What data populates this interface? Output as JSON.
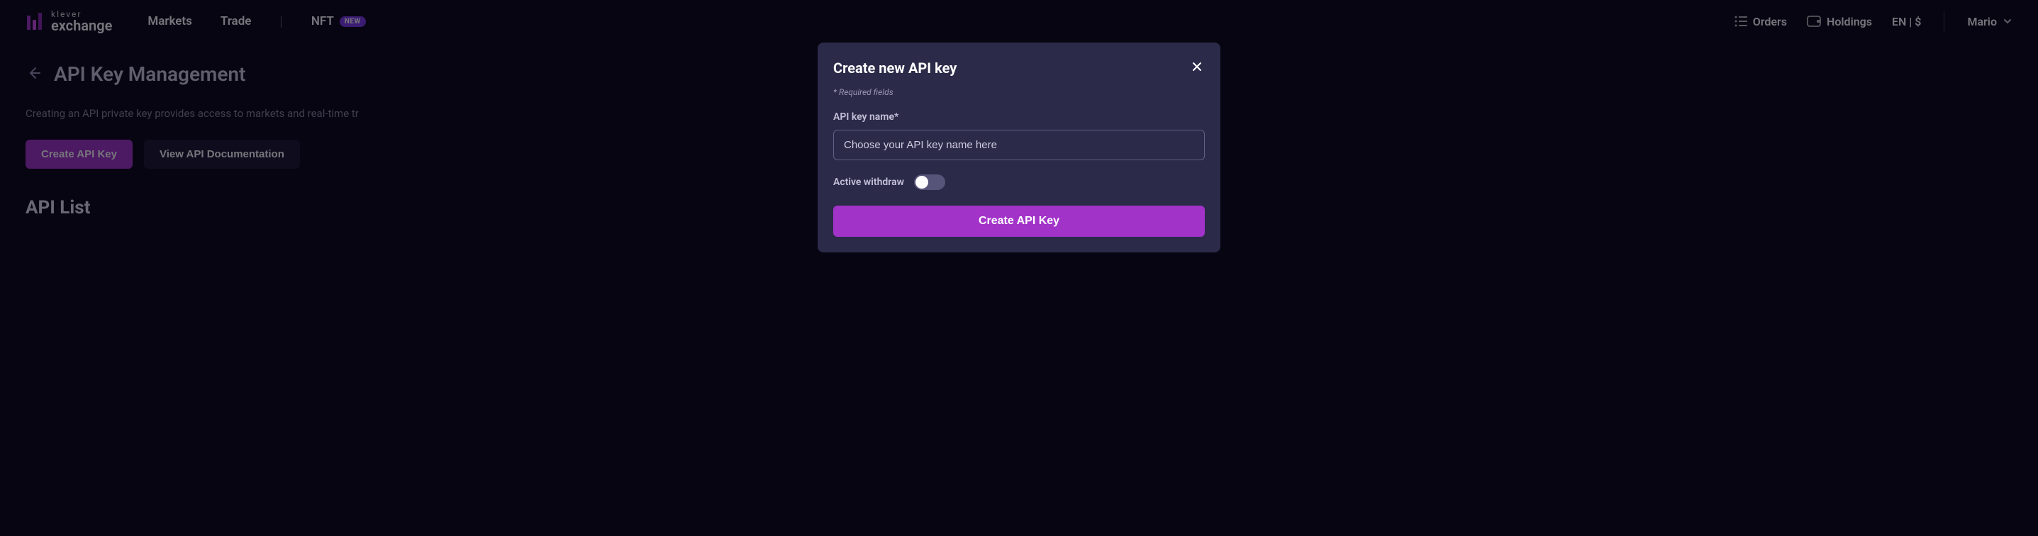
{
  "brand": {
    "top": "klever",
    "bottom": "exchange"
  },
  "nav": {
    "markets": "Markets",
    "trade": "Trade",
    "nft": "NFT",
    "new_badge": "NEW"
  },
  "header_right": {
    "orders": "Orders",
    "holdings": "Holdings",
    "locale": "EN | $",
    "user": "Mario"
  },
  "page": {
    "title": "API Key Management",
    "description": "Creating an API private key provides access to markets and real-time tr",
    "create_btn": "Create API Key",
    "docs_btn": "View API Documentation",
    "list_title": "API List"
  },
  "modal": {
    "title": "Create new API key",
    "required_hint": "* Required fields",
    "name_label": "API key name*",
    "name_placeholder": "Choose your API key name here",
    "withdraw_label": "Active withdraw",
    "submit": "Create API Key"
  }
}
